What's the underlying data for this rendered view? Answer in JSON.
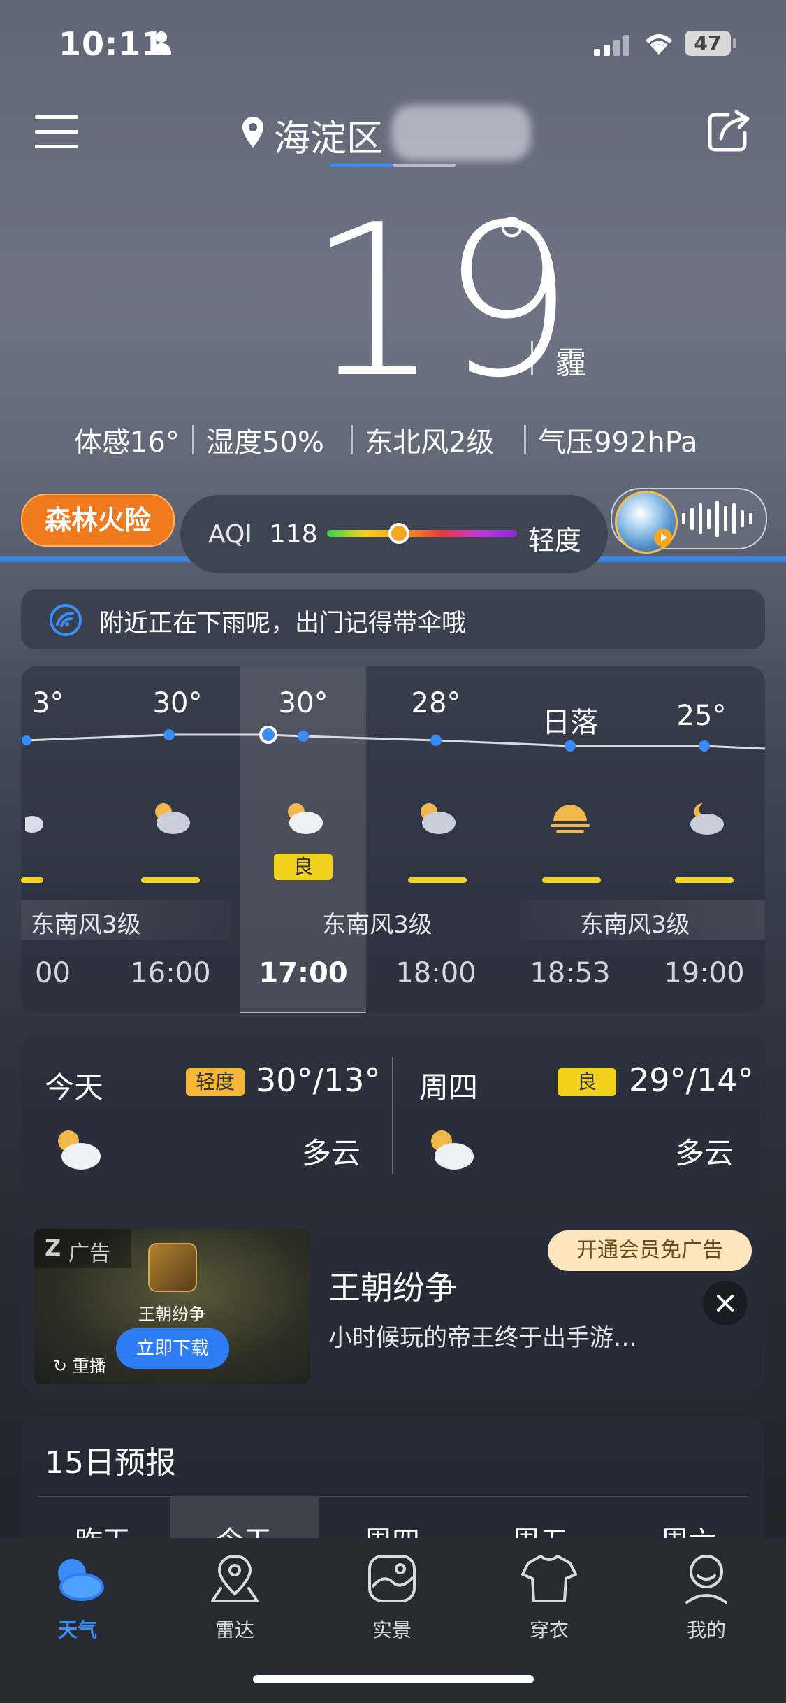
{
  "status_bar": {
    "time": "10:11",
    "battery": "47"
  },
  "header": {
    "location": "海淀区"
  },
  "current": {
    "temp": "19",
    "degree": "°",
    "condition": "霾",
    "metrics": [
      "体感16°",
      "湿度50%",
      "东北风2级",
      "气压992hPa"
    ]
  },
  "alert_badge": "森林火险",
  "aqi": {
    "label": "AQI",
    "value": "118",
    "level": "轻度",
    "fraction": 0.38
  },
  "notice": "附近正在下雨呢，出门记得带伞哦",
  "hourly": {
    "temps": [
      "3°",
      "30°",
      "30°",
      "28°",
      "日落",
      "25°"
    ],
    "aqi_badge": "良",
    "winds": [
      "东南风3级",
      "东南风3级",
      "东南风3级"
    ],
    "times": [
      "00",
      "16:00",
      "17:00",
      "18:00",
      "18:53",
      "19:00"
    ]
  },
  "daily_summary": {
    "today": {
      "name": "今天",
      "aqi": "轻度",
      "temps": "30°/13°",
      "condition": "多云"
    },
    "tomorrow": {
      "name": "周四",
      "aqi": "良",
      "temps": "29°/14°",
      "condition": "多云"
    }
  },
  "ad": {
    "tag": "广告",
    "game_name": "王朝纷争",
    "download": "立即下载",
    "replay": "重播",
    "title": "王朝纷争",
    "desc": "小时候玩的帝王终于出手游…",
    "vip": "开通会员免广告"
  },
  "forecast": {
    "title": "15日预报",
    "days": [
      "昨天",
      "今天",
      "周四",
      "周五",
      "周六"
    ]
  },
  "tabs": [
    "天气",
    "雷达",
    "实景",
    "穿衣",
    "我的"
  ],
  "colors": {
    "accent": "#3b8cf7",
    "alert": "#f07a1e",
    "aqi_light": "#f5b633",
    "aqi_good": "#f2d21c"
  }
}
